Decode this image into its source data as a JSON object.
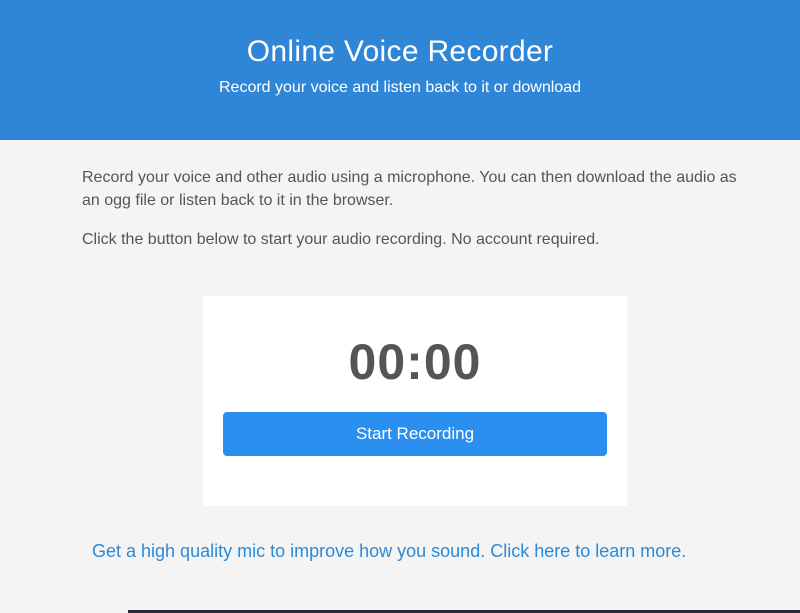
{
  "header": {
    "title": "Online Voice Recorder",
    "subtitle": "Record your voice and listen back to it or download"
  },
  "content": {
    "intro": "Record your voice and other audio using a microphone. You can then download the audio as an ogg file or listen back to it in the browser.",
    "instruction": "Click the button below to start your audio recording. No account required."
  },
  "recorder": {
    "timer": "00:00",
    "start_label": "Start Recording"
  },
  "promo": {
    "link_text": "Get a high quality mic to improve how you sound. Click here to learn more."
  },
  "colors": {
    "header_bg": "#2f86d6",
    "button_bg": "#2b8ff0",
    "link": "#2b8ad8",
    "page_bg": "#f4f4f4"
  }
}
